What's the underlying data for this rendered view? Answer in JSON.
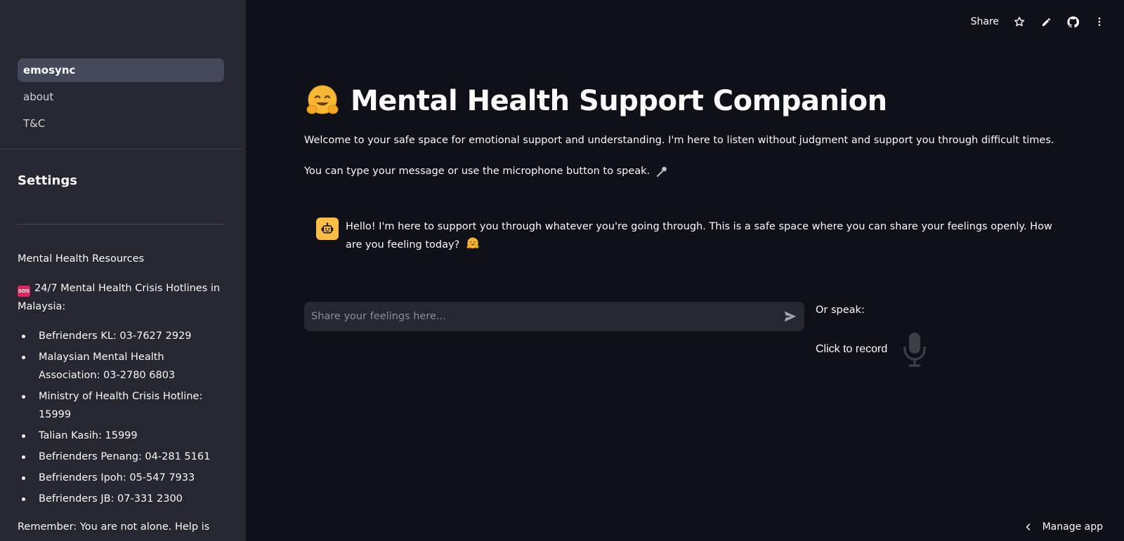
{
  "sidebar": {
    "nav": [
      {
        "label": "emosync",
        "active": true
      },
      {
        "label": "about",
        "active": false
      },
      {
        "label": "T&C",
        "active": false
      }
    ],
    "settings_title": "Settings",
    "resources_heading": "Mental Health Resources",
    "hotlines_intro": "24/7 Mental Health Crisis Hotlines in Malaysia:",
    "sos_badge": "SOS",
    "hotlines": [
      "Befrienders KL: 03-7627 2929",
      "Malaysian Mental Health Association: 03-2780 6803",
      "Ministry of Health Crisis Hotline: 15999",
      "Talian Kasih: 15999",
      "Befrienders Penang: 04-281 5161",
      "Befrienders Ipoh: 05-547 7933",
      "Befrienders JB: 07-331 2300"
    ],
    "remember": "Remember: You are not alone. Help is"
  },
  "toolbar": {
    "share_label": "Share",
    "icons": [
      "star-icon",
      "pencil-icon",
      "github-icon",
      "more-vert-icon"
    ]
  },
  "main": {
    "title": "Mental Health Support Companion",
    "title_emoji": "hugging-face-emoji",
    "intro": "Welcome to your safe space for emotional support and understanding. I'm here to listen without judgment and support you through difficult times.",
    "intro2": "You can type your message or use the microphone button to speak.",
    "bot_message": "Hello! I'm here to support you through whatever you're going through. This is a safe space where you can share your feelings openly. How are you feeling today?",
    "chat_placeholder": "Share your feelings here...",
    "chat_value": "",
    "or_speak": "Or speak:",
    "record_label": "Click to record"
  },
  "footer": {
    "manage_app": "Manage app"
  },
  "colors": {
    "background": "#0e1117",
    "sidebar": "#262730",
    "active_nav": "#45475a",
    "bot_avatar": "#ffbd45",
    "text": "#fafafa"
  }
}
